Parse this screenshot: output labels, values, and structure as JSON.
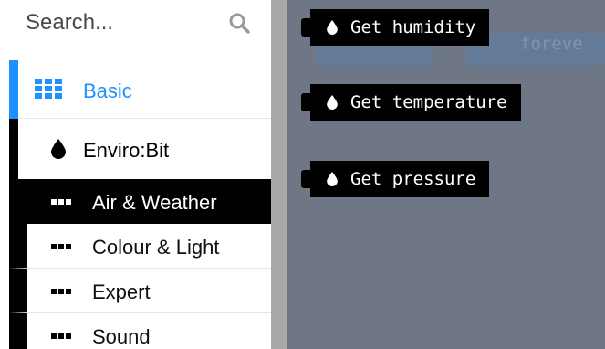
{
  "search": {
    "placeholder": "Search..."
  },
  "categories": {
    "basic": {
      "label": "Basic",
      "icon": "grid-icon",
      "color": "#1e90ff"
    },
    "enviro": {
      "label": "Enviro:Bit",
      "icon": "drop-icon"
    }
  },
  "subcategories": [
    {
      "label": "Air & Weather",
      "active": true
    },
    {
      "label": "Colour & Light"
    },
    {
      "label": "Expert"
    },
    {
      "label": "Sound"
    }
  ],
  "flyout": {
    "blocks": [
      {
        "label": "Get humidity"
      },
      {
        "label": "Get temperature"
      },
      {
        "label": "Get pressure"
      }
    ],
    "background_label": "foreve"
  },
  "colors": {
    "workspace": "#6f7787",
    "block": "#000000",
    "accent": "#1e90ff"
  }
}
